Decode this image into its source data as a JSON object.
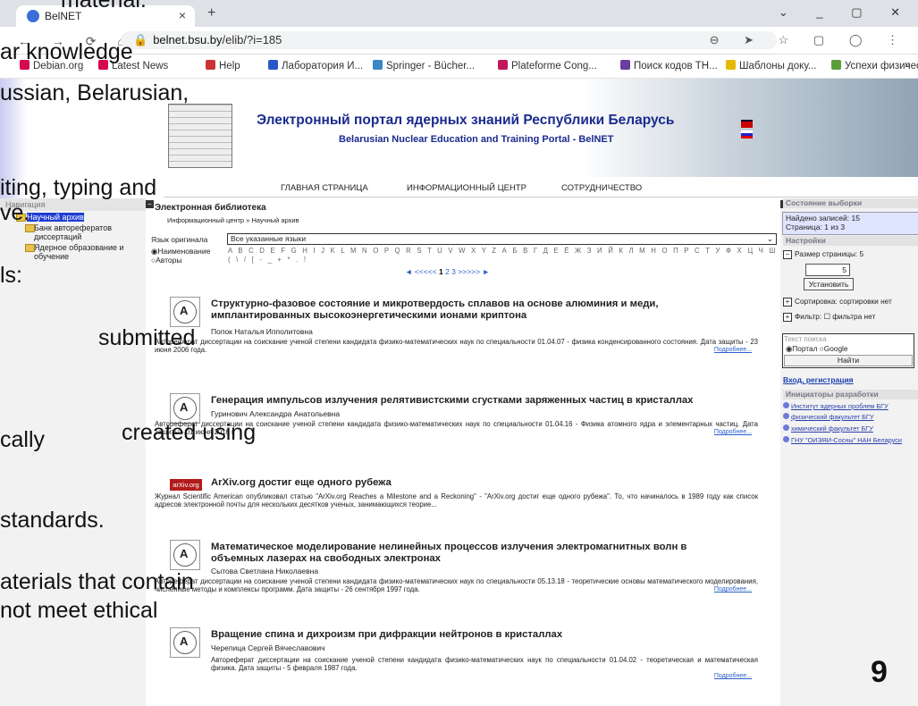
{
  "browser": {
    "tab_title": "BelNET",
    "tab_close": "×",
    "new_tab": "+",
    "window_controls": "⌄ _ ▢ ✕",
    "nav_buttons": "← → ⟳ ⌂",
    "url_host": "belnet.bsu.by",
    "url_path": "/elib/?i=185",
    "addr_icons": "⊖ ➤ ☆ ▢ ◯ ⋮",
    "bookmarks": [
      {
        "label": "Debian.org",
        "color": "#d70751"
      },
      {
        "label": "Latest News",
        "color": "#d70751"
      },
      {
        "label": "Help",
        "color": "#c33"
      },
      {
        "label": "Лаборатория И...",
        "color": "#2a57c7"
      },
      {
        "label": "Springer - Bücher...",
        "color": "#3a88c8"
      },
      {
        "label": "Plateforme Cong...",
        "color": "#c2185b"
      },
      {
        "label": "Поиск кодов ТН...",
        "color": "#6a3fa0"
      },
      {
        "label": "Шаблоны доку...",
        "color": "#e6b800"
      },
      {
        "label": "Успехи физичес...",
        "color": "#5b9e3a"
      }
    ],
    "bookmarks_more": "»"
  },
  "banner": {
    "title": "Электронный портал ядерных знаний Республики Беларусь",
    "subtitle": "Belarusian Nuclear Education and Training Portal - BelNET"
  },
  "topnav": [
    "ГЛАВНАЯ СТРАНИЦА",
    "ИНФОРМАЦИОННЫЙ ЦЕНТР",
    "СОТРУДНИЧЕСТВО"
  ],
  "leftnav": {
    "header": "Навигация",
    "items": [
      "Научный архив",
      "Банк авторефератов диссертаций",
      "Ядерное образование и обучение"
    ]
  },
  "library": {
    "title": "Электронная библиотека",
    "breadcrumb": "Информационный центр » Научный архив",
    "lang_label": "Язык оригинала",
    "lang_value": "Все указанные языки",
    "radio_name": "Наименование",
    "radio_authors": "Авторы",
    "alphabet": "A B C D E F G H I J K L M N O P Q R S T U V W X Y Z А Б В Г Д Е Ё Ж З И Й К Л М Н О П Р С Т У Ф Х Ц Ч Ш Щ Ъ Ы Ь Э Ю Я 0 1 2 3 4 5 6 7 8 9",
    "symbols": "( \\ / [ - _ + * . !",
    "pager_prev": "◄ <<<<<",
    "pager_current": "1",
    "pager_pages": "2 3",
    "pager_next": ">>>>> ►"
  },
  "records": [
    {
      "title": "Структурно-фазовое состояние и микротвердость сплавов на основе алюминия и меди, имплантированных высокоэнергетическими ионами криптона",
      "author": "Попок Наталья Ипполитовна",
      "desc": "Автореферат диссертации на соискание ученой степени кандидата физико-математических наук по специальности 01.04.07 - физика конденсированного состояния. Дата защиты - 23 июня 2006 года.",
      "more": "Подробнее..."
    },
    {
      "title": "Генерация импульсов излучения релятивистскими сгустками заряженных частиц в кристаллах",
      "author": "Гуринович Александра Анатольевна",
      "desc": "Автореферат диссертации на соискание ученой степени кандидата физико-математических наук по специальности 01.04.16 - Физика атомного ядра и элементарных частиц. Дата защиты - 01 июня 2016 г.",
      "more": "Подробнее..."
    },
    {
      "logo": "arXiv.org",
      "title": "ArXiv.org достиг еще одного рубежа",
      "desc": "Журнал Scientific American опубликовал статью \"ArXiv.org Reaches a Milestone and a Reckoning\" - \"ArXiv.org достиг еще одного рубежа\". То, что начиналось в 1989 году как список адресов электронной почты для нескольких десятков ученых, занимающихся теорие..."
    },
    {
      "title": "Математическое моделирование нелинейных процессов излучения электромагнитных волн в объемных лазерах на свободных электронах",
      "author": "Сытова Светлана Николаевна",
      "desc": "Автореферат диссертации на соискание ученой степени кандидата физико-математических наук по специальности 05.13.18 - теоретические основы математического моделирования, численные методы и комплексы программ. Дата защиты - 26 сентября 1997 года.",
      "more": "Подробнее..."
    },
    {
      "title": "Вращение спина и дихроизм при дифракции нейтронов в кристаллах",
      "author": "Черепица Сергей Вячеславович",
      "desc": "Автореферат диссертации на соискание ученой степени кандидата физико-математических наук по специальности 01.04.02 - теоретическая и математическая физика. Дата защиты - 5 февраля 1987 года.",
      "more": "Подробнее..."
    }
  ],
  "rpanel": {
    "state_header": "Состояние выборки",
    "found": "Найдено записей: 15",
    "page": "Страница: 1 из 3",
    "settings_header": "Настройки",
    "page_size": "Размер страницы: 5",
    "page_size_value": "5",
    "set_button": "Установить",
    "sort": "Сортировка: сортировки нет",
    "filter": "Фильтр: ☐ фильтра нет",
    "search_placeholder": "Текст поиска",
    "search_opt_portal": "Портал",
    "search_opt_google": "Google",
    "search_button": "Найти",
    "login": "Вход, регистрация",
    "initiators_header": "Инициаторы разработки",
    "initiators": [
      "Институт ядерных проблем БГУ",
      "физический факультет БГУ",
      "химический факультет БГУ",
      "ГНУ \"ОИЭЯИ-Сосны\" НАН Беларуси"
    ]
  },
  "slide_overlay": {
    "line1": "material.",
    "line2": "ar knowledge",
    "line3": "ussian, Belarusian,",
    "line4": "iting, typing and",
    "line5": "ve.",
    "line6": "ls:",
    "line7": "submitted",
    "line8": "cally",
    "line9": "created using",
    "line10": "standards.",
    "line11": "aterials that contain",
    "line12": "not meet ethical",
    "page_number": "9"
  }
}
